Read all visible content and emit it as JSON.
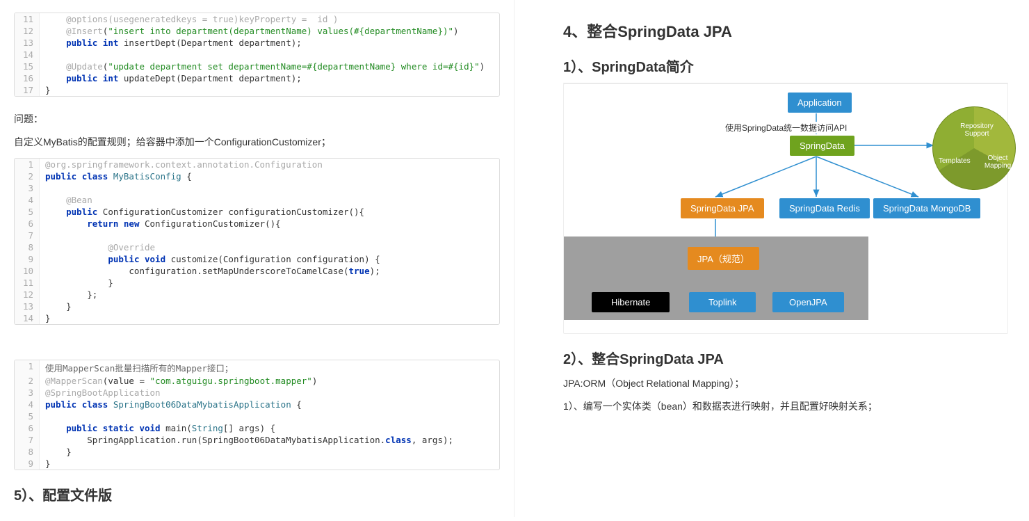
{
  "left": {
    "code1": [
      {
        "n": 11,
        "raw": "    @options(usegeneratedkeys = true)keyProperty =  id )",
        "cls": "k-anno"
      },
      {
        "n": 12,
        "tokens": [
          [
            "    ",
            ""
          ],
          [
            "@Insert",
            "k-anno"
          ],
          [
            "(",
            ""
          ],
          [
            "\"insert into department(departmentName) values(#{departmentName})\"",
            "k-str"
          ],
          [
            ")",
            ""
          ]
        ]
      },
      {
        "n": 13,
        "tokens": [
          [
            "    ",
            ""
          ],
          [
            "public",
            "k-kw"
          ],
          [
            " ",
            ""
          ],
          [
            "int",
            "k-kw"
          ],
          [
            " insertDept(Department department);",
            ""
          ]
        ]
      },
      {
        "n": 14,
        "raw": ""
      },
      {
        "n": 15,
        "tokens": [
          [
            "    ",
            ""
          ],
          [
            "@Update",
            "k-anno"
          ],
          [
            "(",
            ""
          ],
          [
            "\"update department set departmentName=#{departmentName} where id=#{id}\"",
            "k-str"
          ],
          [
            ")",
            ""
          ]
        ]
      },
      {
        "n": 16,
        "tokens": [
          [
            "    ",
            ""
          ],
          [
            "public",
            "k-kw"
          ],
          [
            " ",
            ""
          ],
          [
            "int",
            "k-kw"
          ],
          [
            " updateDept(Department department);",
            ""
          ]
        ]
      },
      {
        "n": 17,
        "raw": "}"
      }
    ],
    "p_problem": "问题：",
    "p_custom": "自定义MyBatis的配置规则；给容器中添加一个ConfigurationCustomizer；",
    "code2": [
      {
        "n": 1,
        "raw": "@org.springframework.context.annotation.Configuration",
        "cls": "k-anno"
      },
      {
        "n": 2,
        "tokens": [
          [
            "public",
            "k-kw"
          ],
          [
            " ",
            ""
          ],
          [
            "class",
            "k-kw"
          ],
          [
            " ",
            ""
          ],
          [
            "MyBatisConfig",
            "k-cls"
          ],
          [
            " {",
            ""
          ]
        ]
      },
      {
        "n": 3,
        "raw": ""
      },
      {
        "n": 4,
        "raw": "    @Bean",
        "cls": "k-anno"
      },
      {
        "n": 5,
        "tokens": [
          [
            "    ",
            ""
          ],
          [
            "public",
            "k-kw"
          ],
          [
            " ConfigurationCustomizer configurationCustomizer(){",
            ""
          ]
        ]
      },
      {
        "n": 6,
        "tokens": [
          [
            "        ",
            ""
          ],
          [
            "return",
            "k-kw"
          ],
          [
            " ",
            ""
          ],
          [
            "new",
            "k-kw"
          ],
          [
            " ConfigurationCustomizer(){",
            ""
          ]
        ]
      },
      {
        "n": 7,
        "raw": ""
      },
      {
        "n": 8,
        "raw": "            @Override",
        "cls": "k-anno"
      },
      {
        "n": 9,
        "tokens": [
          [
            "            ",
            ""
          ],
          [
            "public",
            "k-kw"
          ],
          [
            " ",
            ""
          ],
          [
            "void",
            "k-kw"
          ],
          [
            " customize(Configuration configuration) {",
            ""
          ]
        ]
      },
      {
        "n": 10,
        "tokens": [
          [
            "                configuration.setMapUnderscoreToCamelCase(",
            ""
          ],
          [
            "true",
            "k-bool"
          ],
          [
            ");",
            ""
          ]
        ]
      },
      {
        "n": 11,
        "raw": "            }"
      },
      {
        "n": 12,
        "raw": "        };"
      },
      {
        "n": 13,
        "raw": "    }"
      },
      {
        "n": 14,
        "raw": "}"
      }
    ],
    "code3": [
      {
        "n": 1,
        "raw": "使用MapperScan批量扫描所有的Mapper接口；",
        "cls": "k-cmt"
      },
      {
        "n": 2,
        "tokens": [
          [
            "@MapperScan",
            "k-anno"
          ],
          [
            "(value = ",
            ""
          ],
          [
            "\"com.atguigu.springboot.mapper\"",
            "k-str"
          ],
          [
            ")",
            ""
          ]
        ]
      },
      {
        "n": 3,
        "raw": "@SpringBootApplication",
        "cls": "k-anno"
      },
      {
        "n": 4,
        "tokens": [
          [
            "public",
            "k-kw"
          ],
          [
            " ",
            ""
          ],
          [
            "class",
            "k-kw"
          ],
          [
            " ",
            ""
          ],
          [
            "SpringBoot06DataMybatisApplication",
            "k-cls"
          ],
          [
            " {",
            ""
          ]
        ]
      },
      {
        "n": 5,
        "raw": ""
      },
      {
        "n": 6,
        "tokens": [
          [
            "    ",
            ""
          ],
          [
            "public",
            "k-kw"
          ],
          [
            " ",
            ""
          ],
          [
            "static",
            "k-kw"
          ],
          [
            " ",
            ""
          ],
          [
            "void",
            "k-kw"
          ],
          [
            " main(",
            ""
          ],
          [
            "String",
            "k-cls"
          ],
          [
            "[] args) {",
            ""
          ]
        ]
      },
      {
        "n": 7,
        "tokens": [
          [
            "        SpringApplication.run(SpringBoot06DataMybatisApplication.",
            ""
          ],
          [
            "class",
            "k-kw"
          ],
          [
            ", args);",
            ""
          ]
        ]
      },
      {
        "n": 8,
        "raw": "    }"
      },
      {
        "n": 9,
        "raw": "}"
      }
    ],
    "heading5": "5）、配置文件版"
  },
  "right": {
    "heading4": "4、整合SpringData JPA",
    "heading_intro": "1）、SpringData简介",
    "diagram": {
      "api_label": "使用SpringData统一数据访问API",
      "application": "Application",
      "springdata": "SpringData",
      "jpa": "SpringData JPA",
      "redis": "SpringData Redis",
      "mongo": "SpringData MongoDB",
      "jpa_spec": "JPA（规范）",
      "hibernate": "Hibernate",
      "toplink": "Toplink",
      "openjpa": "OpenJPA",
      "pie1": "Repository Support",
      "pie2": "Templates",
      "pie3": "Object Mapping"
    },
    "heading_int": "2）、整合SpringData JPA",
    "p_orm": "JPA:ORM（Object Relational Mapping）；",
    "p_step1": "1）、编写一个实体类（bean）和数据表进行映射，并且配置好映射关系；"
  }
}
